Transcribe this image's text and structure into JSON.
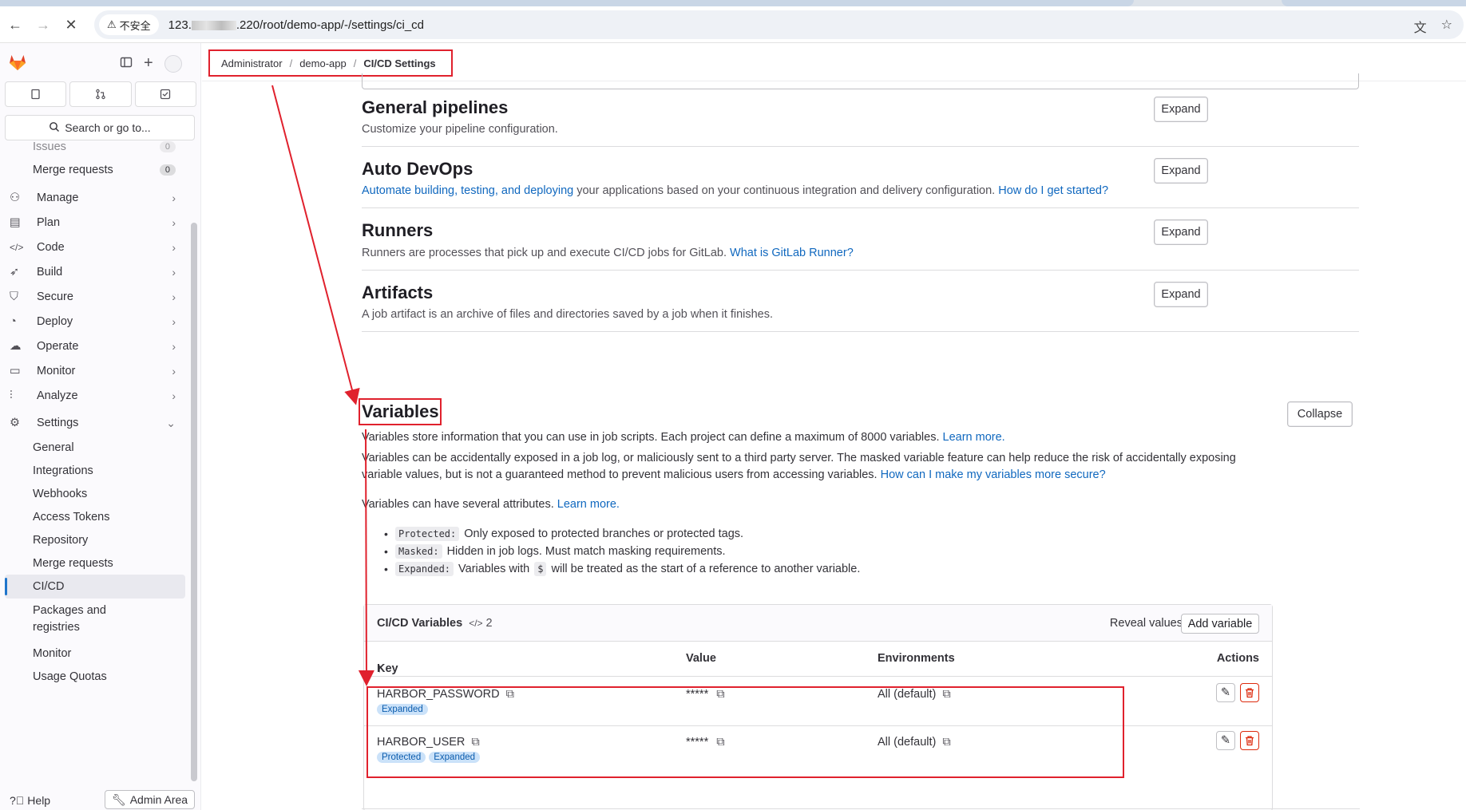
{
  "browser": {
    "security_label": "不安全",
    "url_prefix": "123.",
    "url_suffix": ".220/root/demo-app/-/settings/ci_cd"
  },
  "breadcrumb": {
    "items": [
      "Administrator",
      "demo-app",
      "CI/CD Settings"
    ]
  },
  "sidebar": {
    "search_label": "Search or go to...",
    "items": [
      {
        "label": "Issues",
        "count": "0"
      },
      {
        "label": "Merge requests",
        "count": "0"
      },
      {
        "label": "Manage"
      },
      {
        "label": "Plan"
      },
      {
        "label": "Code"
      },
      {
        "label": "Build"
      },
      {
        "label": "Secure"
      },
      {
        "label": "Deploy"
      },
      {
        "label": "Operate"
      },
      {
        "label": "Monitor"
      },
      {
        "label": "Analyze"
      },
      {
        "label": "Settings"
      }
    ],
    "settings_sub": [
      "General",
      "Integrations",
      "Webhooks",
      "Access Tokens",
      "Repository",
      "Merge requests",
      "CI/CD",
      "Packages and",
      "registries",
      "Monitor",
      "Usage Quotas"
    ],
    "help_label": "Help",
    "admin_label": "Admin Area"
  },
  "sections": [
    {
      "title": "General pipelines",
      "desc": "Customize your pipeline configuration.",
      "button": "Expand"
    },
    {
      "title": "Auto DevOps",
      "desc_link1": "Automate building, testing, and deploying",
      "desc_mid": " your applications based on your continuous integration and delivery configuration. ",
      "desc_link2": "How do I get started?",
      "button": "Expand"
    },
    {
      "title": "Runners",
      "desc": "Runners are processes that pick up and execute CI/CD jobs for GitLab. ",
      "desc_link": "What is GitLab Runner?",
      "button": "Expand"
    },
    {
      "title": "Artifacts",
      "desc": "A job artifact is an archive of files and directories saved by a job when it finishes.",
      "button": "Expand"
    }
  ],
  "variables": {
    "title": "Variables",
    "button": "Collapse",
    "line1": "Variables store information that you can use in job scripts. Each project can define a maximum of 8000 variables. ",
    "line1_link": "Learn more.",
    "line2a": "Variables can be accidentally exposed in a job log, or maliciously sent to a third party server. The masked variable feature can help reduce the risk of accidentally exposing",
    "line2b": "variable values, but is not a guaranteed method to prevent malicious users from accessing variables. ",
    "line2_link": "How can I make my variables more secure?",
    "line3": "Variables can have several attributes. ",
    "line3_link": "Learn more.",
    "attrs": [
      {
        "code": "Protected:",
        "text": "Only exposed to protected branches or protected tags."
      },
      {
        "code": "Masked:",
        "text": "Hidden in job logs. Must match masking requirements."
      },
      {
        "code": "Expanded:",
        "text_a": "Variables with",
        "code2": "$",
        "text_b": "will be treated as the start of a reference to another variable."
      }
    ],
    "table": {
      "title": "CI/CD Variables",
      "count": "2",
      "reveal": "Reveal values",
      "add": "Add variable",
      "headers": [
        "Key",
        "Value",
        "Environments",
        "Actions"
      ],
      "rows": [
        {
          "key": "HARBOR_PASSWORD",
          "value": "*****",
          "env": "All (default)",
          "badges": [
            "Expanded"
          ]
        },
        {
          "key": "HARBOR_USER",
          "value": "*****",
          "env": "All (default)",
          "badges": [
            "Protected",
            "Expanded"
          ]
        }
      ]
    }
  },
  "colors": {
    "accent": "#1068bf",
    "annotation": "#e0212d",
    "danger": "#dd2b0e"
  }
}
